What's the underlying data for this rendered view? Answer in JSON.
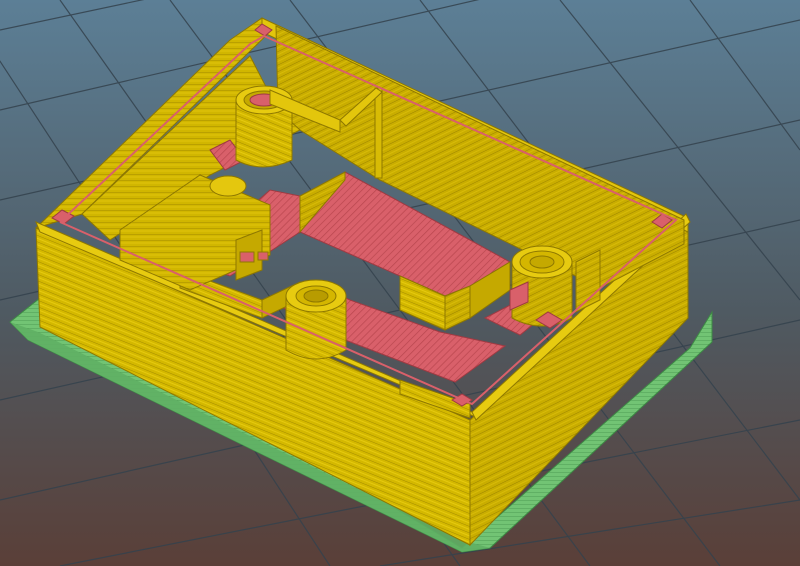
{
  "viewport": {
    "background_top": "#5c7f96",
    "background_bottom": "#5a3f38",
    "grid_color": "#3b4a55"
  },
  "colors": {
    "wall": "#d1b600",
    "wall_dark": "#a99000",
    "wall_light": "#e8cc10",
    "line": "#9a8400",
    "infill": "#d9606a",
    "infill_line": "#b84a55",
    "skirt": "#6fc070",
    "skirt_line": "#4a9a50"
  },
  "model": {
    "object": "sliced-enclosure-preview",
    "features": [
      "outer-wall",
      "skirt",
      "infill",
      "round-posts",
      "inner-partitions"
    ]
  }
}
